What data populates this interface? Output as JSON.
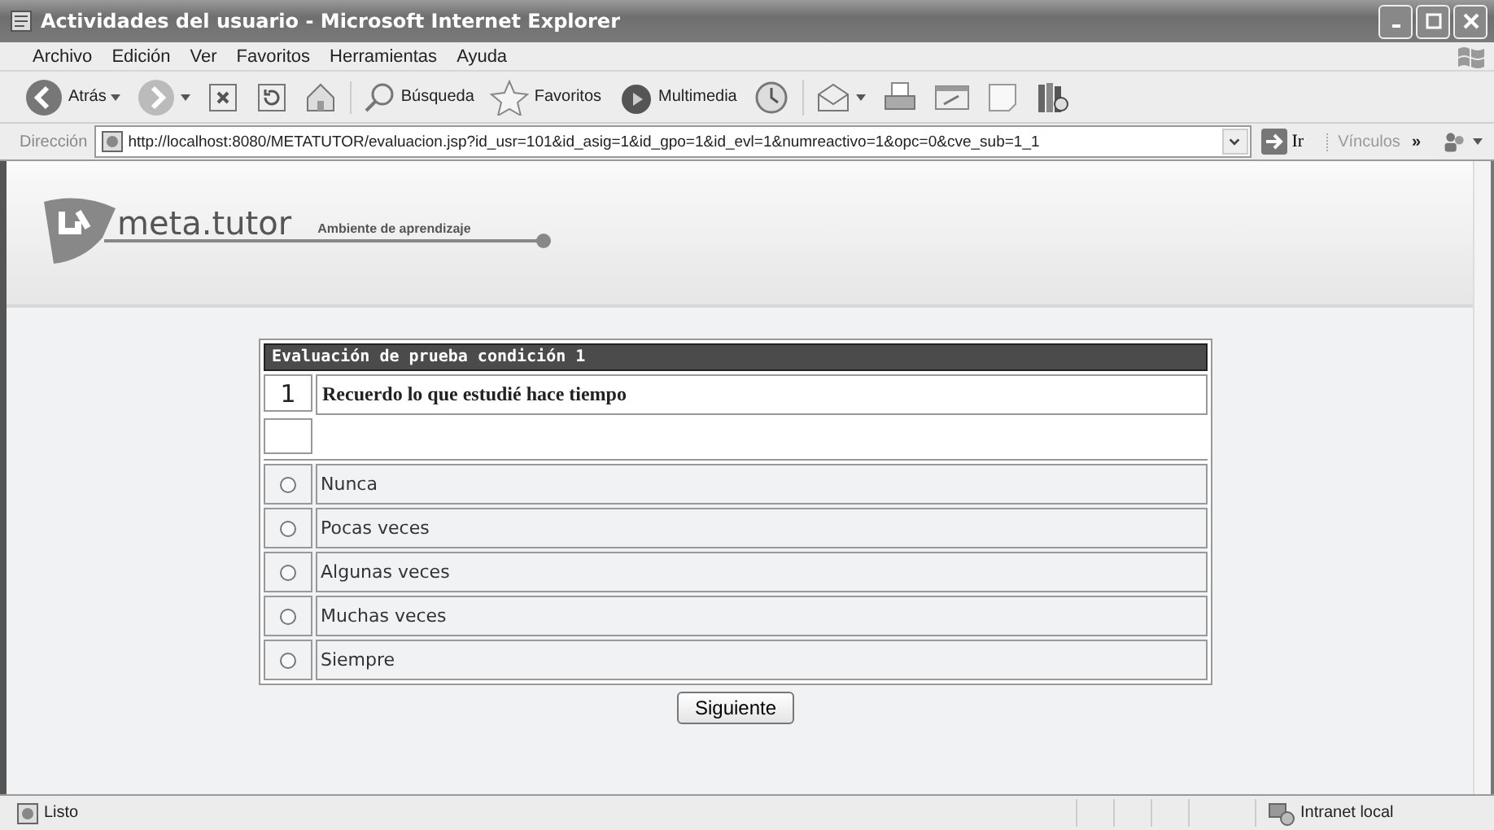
{
  "window": {
    "title": "Actividades del usuario - Microsoft Internet Explorer"
  },
  "menu": [
    "Archivo",
    "Edición",
    "Ver",
    "Favoritos",
    "Herramientas",
    "Ayuda"
  ],
  "toolbar": [
    {
      "kind": "back",
      "label": "Atrás"
    },
    {
      "kind": "forward"
    },
    {
      "kind": "stop"
    },
    {
      "kind": "refresh"
    },
    {
      "kind": "home"
    },
    {
      "kind": "search",
      "label": "Búsqueda"
    },
    {
      "kind": "favorites",
      "label": "Favoritos"
    },
    {
      "kind": "media",
      "label": "Multimedia"
    },
    {
      "kind": "history"
    },
    {
      "kind": "mail"
    },
    {
      "kind": "print"
    },
    {
      "kind": "edit"
    },
    {
      "kind": "discuss"
    },
    {
      "kind": "research"
    }
  ],
  "address": {
    "label": "Dirección",
    "url": "http://localhost:8080/METATUTOR/evaluacion.jsp?id_usr=101&id_asig=1&id_gpo=1&id_evl=1&numreactivo=1&opc=0&cve_sub=1_1",
    "go": "Ir",
    "links": "Vínculos",
    "more": "»"
  },
  "page": {
    "brand": "meta.tutor",
    "tagline": "Ambiente de aprendizaje",
    "test_title": "Evaluación de prueba condición 1",
    "question": {
      "number": "1",
      "text": "Recuerdo lo que estudié hace tiempo"
    },
    "options": [
      {
        "label": "Nunca",
        "selected": false
      },
      {
        "label": "Pocas veces",
        "selected": false
      },
      {
        "label": "Algunas veces",
        "selected": false
      },
      {
        "label": "Muchas veces",
        "selected": false
      },
      {
        "label": "Siempre",
        "selected": false
      }
    ],
    "submit": "Siguiente"
  },
  "status_bar": {
    "text": "Listo",
    "zone": "Intranet local"
  }
}
